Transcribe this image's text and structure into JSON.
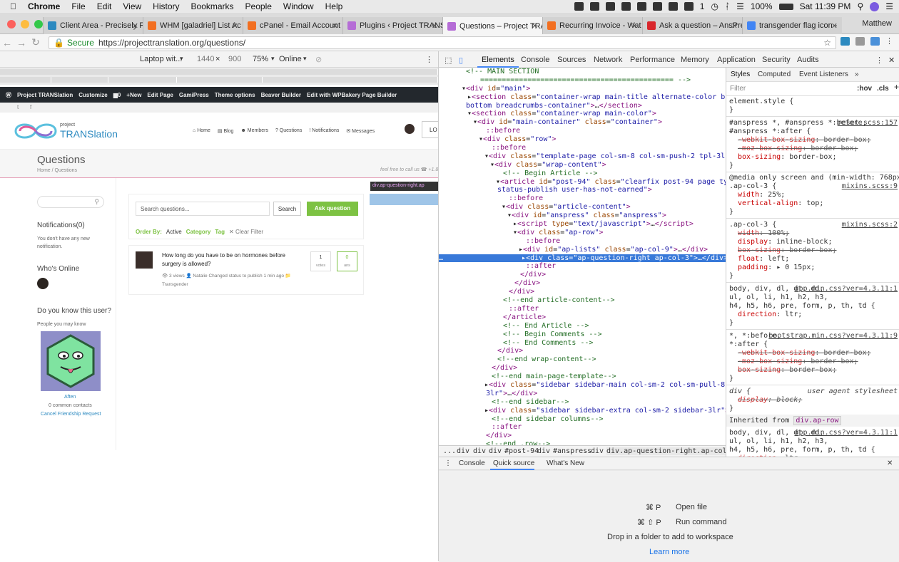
{
  "menubar": {
    "app": "Chrome",
    "items": [
      "File",
      "Edit",
      "View",
      "History",
      "Bookmarks",
      "People",
      "Window",
      "Help"
    ],
    "battery": "100%",
    "notif_count": "1",
    "clock": "Sat 11:39 PM"
  },
  "tabs": [
    {
      "label": "Client Area - Precisely F",
      "fav": "#2d8ac0"
    },
    {
      "label": "WHM [galadriel] List Ac",
      "fav": "#f26f21"
    },
    {
      "label": "cPanel - Email Account",
      "fav": "#f26f21"
    },
    {
      "label": "Plugins ‹ Project TRANS",
      "fav": "#b56dd6"
    },
    {
      "label": "Questions – Project TRA",
      "fav": "#b56dd6"
    },
    {
      "label": "Recurring Invoice - Wat",
      "fav": "#f26f21"
    },
    {
      "label": "Ask a question – AnsPre",
      "fav": "#d9262c"
    },
    {
      "label": "transgender flag icon -",
      "fav": "#4285f4"
    }
  ],
  "profile_name": "Matthew",
  "address": {
    "secure": "Secure",
    "url": "https://projecttranslation.org/questions/"
  },
  "device_toolbar": {
    "device": "Laptop wit...",
    "width": "1440",
    "height": "900",
    "zoom": "75%",
    "network": "Online",
    "x": "×"
  },
  "wp_admin": {
    "items": [
      "Project TRANSlation",
      "Customize",
      "0",
      "New",
      "Edit Page",
      "GamiPress",
      "Theme options",
      "Beaver Builder",
      "Edit with WPBakery Page Builder"
    ]
  },
  "site": {
    "logo_small": "project",
    "logo_big": "TRANSlation",
    "nav": [
      "Home",
      "Blog",
      "Members",
      "Questions",
      "Notifications",
      "Messages"
    ],
    "login": "LO",
    "page_title": "Questions",
    "breadcrumb": "Home  /  Questions",
    "feel_free": "feel free to call us  ☎ +1.8"
  },
  "sidebar": {
    "notifications_title": "Notifications(0)",
    "notifications_text": "You don't have any new notification.",
    "whos_online": "Who's Online",
    "know_user": "Do you know this user?",
    "people_know": "People you may know",
    "user_name": "Aften",
    "common": "0 common contacts",
    "cancel": "Cancel Friendship Request"
  },
  "questions": {
    "search_placeholder": "Search questions...",
    "search_btn": "Search",
    "ask_btn": "Ask question",
    "order_by": "Order By:",
    "active": "Active",
    "category": "Category",
    "tag": "Tag",
    "clear": "✕ Clear Filter",
    "item": {
      "title": "How long do you have to be on hormones before surgery is allowed?",
      "meta": "👁 3 views  👤 Natalie Changed status to publish 1 min ago   📁 Transgender",
      "votes": "1",
      "votes_label": "votes",
      "answers": "0",
      "answers_label": "ans"
    }
  },
  "highlight_tip": "div.ap-question-right.ap",
  "devtools": {
    "tabs": [
      "Elements",
      "Console",
      "Sources",
      "Network",
      "Performance",
      "Memory",
      "Application",
      "Security",
      "Audits"
    ],
    "crumbs": [
      "...",
      "div",
      "div",
      "div",
      "#post-94",
      "div",
      "#anspress",
      "div",
      "div.ap-question-right.ap-col-3"
    ],
    "style_tabs": [
      "Styles",
      "Computed",
      "Event Listeners",
      "»"
    ],
    "filter": "Filter",
    "hov": ":hov",
    "cls": ".cls",
    "drawer_tabs": [
      "Console",
      "Quick source",
      "What's New"
    ],
    "shortcuts": [
      {
        "keys": "⌘ P",
        "action": "Open file"
      },
      {
        "keys": "⌘ ⇧ P",
        "action": "Run command"
      }
    ],
    "drop_text": "Drop in a folder to add to workspace",
    "learn_more": "Learn more"
  }
}
